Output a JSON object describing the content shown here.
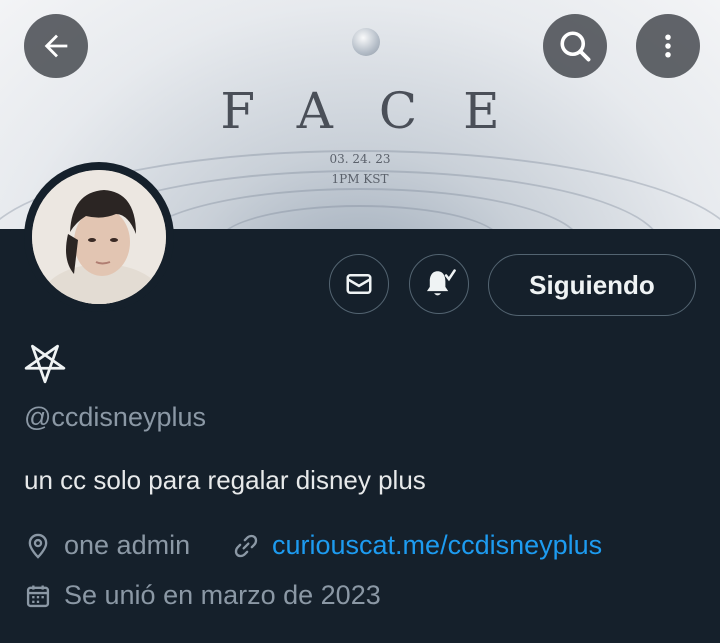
{
  "banner": {
    "title": "FACE",
    "date": "03. 24. 23",
    "time": "1PM KST"
  },
  "header": {
    "back_icon": "arrow-left-icon",
    "search_icon": "search-icon",
    "more_icon": "more-vertical-icon"
  },
  "actions": {
    "message_icon": "envelope-icon",
    "notify_icon": "bell-check-icon",
    "follow_label": "Siguiendo"
  },
  "profile": {
    "name_icon": "pentagram-icon",
    "handle": "@ccdisneyplus",
    "bio": "un cc solo para regalar disney plus",
    "location": "one admin",
    "website": "curiouscat.me/ccdisneyplus",
    "joined": "Se unió en marzo de 2023"
  },
  "colors": {
    "background": "#15202b",
    "link": "#1d9bf0",
    "muted": "#8b98a5"
  }
}
